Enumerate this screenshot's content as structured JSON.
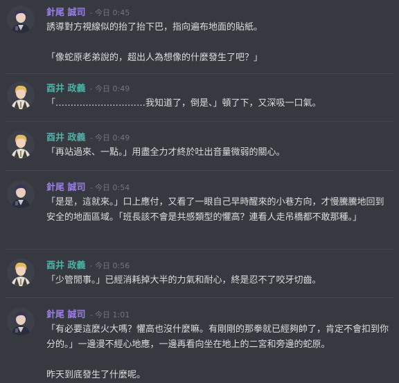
{
  "colors": {
    "background": "#36393f",
    "text": "#dcddde",
    "timestamp": "#72767d",
    "name_purple": "#9b7de8",
    "name_teal": "#4fb1a6"
  },
  "messages": [
    {
      "author": "針尾 誠司",
      "author_color": "#9b7de8",
      "avatar": "dark-haired-officer-avatar",
      "timestamp": "今日 0:45",
      "paragraphs": [
        "誘導對方視線似的抬了抬下巴，指向遍布地面的貼紙。",
        "「像蛇原老弟說的，超出人為想像的什麼發生了吧？」"
      ]
    },
    {
      "author": "酉井 政義",
      "author_color": "#4fb1a6",
      "avatar": "blond-man-avatar",
      "timestamp": "今日 0:49",
      "paragraphs": [
        "「…………………………我知道了，倒是、」頓了下，又深吸一口氣。"
      ]
    },
    {
      "author": "酉井 政義",
      "author_color": "#4fb1a6",
      "avatar": "blond-man-avatar",
      "timestamp": "今日 0:49",
      "paragraphs": [
        "「再站過來、一點。」用盡全力才終於吐出音量微弱的關心。"
      ]
    },
    {
      "author": "針尾 誠司",
      "author_color": "#9b7de8",
      "avatar": "dark-haired-officer-avatar",
      "timestamp": "今日 0:54",
      "paragraphs": [
        "「是是，這就來。」口上應付，又看了一眼自己早時醒來的小巷方向，才慢騰騰地回到安全的地面區域。「班長該不會是共感類型的懼高？連看人走吊橋都不敢那種。」"
      ]
    },
    {
      "author": "酉井 政義",
      "author_color": "#4fb1a6",
      "avatar": "blond-man-avatar",
      "timestamp": "今日 0:56",
      "paragraphs": [
        "「少管閒事。」已經消耗掉大半的力氣和耐心，終是忍不了咬牙切齒。"
      ]
    },
    {
      "author": "針尾 誠司",
      "author_color": "#9b7de8",
      "avatar": "dark-haired-officer-avatar",
      "timestamp": "今日 1:01",
      "paragraphs": [
        "「有必要這麼火大嗎？懼高也沒什麼嘛。有剛剛的那拳就已經夠帥了，肯定不會扣到你分的。」一邊漫不經心地應，一邊再看向坐在地上的二宮和旁邊的蛇原。",
        "昨天到底發生了什麼呢。"
      ]
    }
  ]
}
